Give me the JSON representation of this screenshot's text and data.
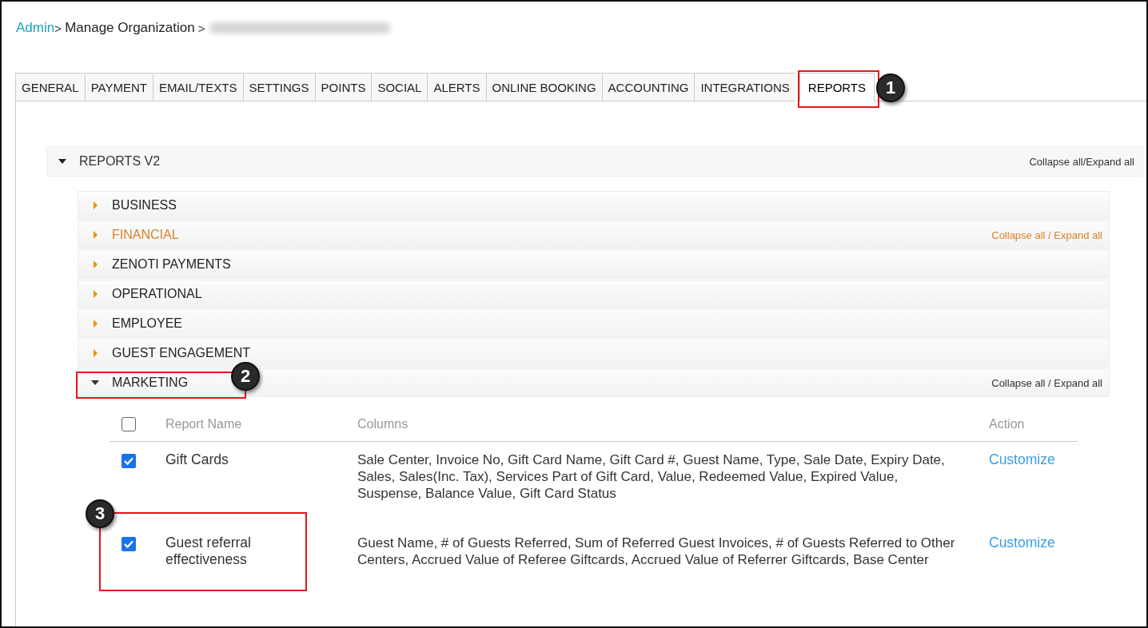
{
  "breadcrumb": [
    {
      "label": "Admin",
      "kind": "link"
    },
    {
      "label": "> ",
      "kind": "sep"
    },
    {
      "label": "Manage Organization",
      "kind": "text"
    },
    {
      "label": " >",
      "kind": "sep"
    },
    {
      "kind": "redacted"
    }
  ],
  "tabs": [
    {
      "label": "GENERAL",
      "selected": false
    },
    {
      "label": "PAYMENT",
      "selected": false
    },
    {
      "label": "EMAIL/TEXTS",
      "selected": false
    },
    {
      "label": "SETTINGS",
      "selected": false
    },
    {
      "label": "POINTS",
      "selected": false
    },
    {
      "label": "SOCIAL",
      "selected": false
    },
    {
      "label": "ALERTS",
      "selected": false
    },
    {
      "label": "ONLINE BOOKING",
      "selected": false
    },
    {
      "label": "ACCOUNTING",
      "selected": false
    },
    {
      "label": "INTEGRATIONS",
      "selected": false
    },
    {
      "label": "REPORTS",
      "selected": true
    }
  ],
  "reports_panel": {
    "title": "REPORTS V2",
    "expanded": true,
    "action": "Collapse all/Expand all",
    "sections": [
      {
        "title": "BUSINESS",
        "expanded": false,
        "hovered": false
      },
      {
        "title": "FINANCIAL",
        "expanded": false,
        "hovered": true,
        "action": "Collapse all / Expand all"
      },
      {
        "title": "ZENOTI PAYMENTS",
        "expanded": false,
        "hovered": false
      },
      {
        "title": "OPERATIONAL",
        "expanded": false,
        "hovered": false
      },
      {
        "title": "EMPLOYEE",
        "expanded": false,
        "hovered": false
      },
      {
        "title": "GUEST ENGAGEMENT",
        "expanded": false,
        "hovered": false
      },
      {
        "title": "MARKETING",
        "expanded": true,
        "hovered": false,
        "action": "Collapse all / Expand all",
        "table": {
          "all_checked": false,
          "columns": [
            "Report Name",
            "Columns",
            "Action"
          ],
          "rows": [
            {
              "checked": true,
              "name": "Gift Cards",
              "columns": "Sale Center, Invoice No, Gift Card Name, Gift Card #, Guest Name, Type, Sale Date, Expiry Date, Sales, Sales(Inc. Tax), Services Part of Gift Card, Value, Redeemed Value, Expired Value, Suspense, Balance Value, Gift Card Status",
              "action": "Customize"
            },
            {
              "checked": true,
              "name": "Guest referral effectiveness",
              "columns": "Guest Name, # of Guests Referred, Sum of Referred Guest Invoices, # of Guests Referred to Other Centers, Accrued Value of Referee Giftcards, Accrued Value of Referrer Giftcards, Base Center",
              "action": "Customize"
            }
          ]
        }
      }
    ]
  },
  "annotations": [
    {
      "label": "1"
    },
    {
      "label": "2"
    },
    {
      "label": "3"
    }
  ]
}
